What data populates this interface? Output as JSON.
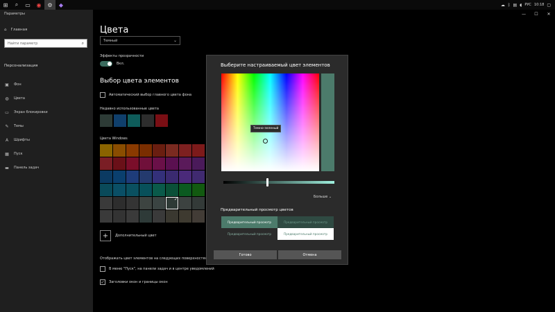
{
  "taskbar": {
    "lang": "РУС",
    "time": "10:18",
    "icons": [
      "windows-icon",
      "search-icon",
      "task-view-icon",
      "chrome-icon",
      "settings-icon",
      "visual-studio-icon"
    ]
  },
  "sidebar": {
    "app_title": "Параметры",
    "home": "Главная",
    "search_placeholder": "Найти параметр",
    "section": "Персонализация",
    "items": [
      {
        "label": "Фон",
        "icon": "image-icon"
      },
      {
        "label": "Цвета",
        "icon": "palette-icon"
      },
      {
        "label": "Экран блокировки",
        "icon": "lock-screen-icon"
      },
      {
        "label": "Темы",
        "icon": "themes-icon"
      },
      {
        "label": "Шрифты",
        "icon": "font-icon"
      },
      {
        "label": "Пуск",
        "icon": "start-icon"
      },
      {
        "label": "Панель задач",
        "icon": "taskbar-icon"
      }
    ]
  },
  "main": {
    "title": "Цвета",
    "mode_value": "Темный",
    "transparency_label": "Эффекты прозрачности",
    "transparency_state": "Вкл.",
    "choose_color_heading": "Выбор цвета элементов",
    "auto_color_label": "Автоматический выбор главного цвета фона",
    "recent_label": "Недавно использованные цвета",
    "recent_colors": [
      "#2d3b36",
      "#0f3f6b",
      "#0e5c5a",
      "#2d2d2d",
      "#7a0e14"
    ],
    "windows_colors_label": "Цвета Windows",
    "windows_colors": [
      "#8a6400",
      "#8a4d00",
      "#8a3a00",
      "#7a2e00",
      "#6a1e10",
      "#7a2a20",
      "#7d2020",
      "#7d1a1a",
      "#7a1e25",
      "#6a1018",
      "#7a0e2a",
      "#70103a",
      "#6a1048",
      "#5a1050",
      "#5a1a5a",
      "#4a1a5a",
      "#0b3a62",
      "#0a3f6e",
      "#1e3c7a",
      "#243a6e",
      "#33307a",
      "#3a2a70",
      "#4a2a7a",
      "#402a70",
      "#0a4a5a",
      "#0a4f66",
      "#0a5060",
      "#08505a",
      "#0a5a4a",
      "#0a5038",
      "#0b5a20",
      "#125a10",
      "#3a3a3a",
      "#2d2d2d",
      "#343434",
      "#3d4441",
      "#3a4442",
      "#2e3a36",
      "#3c4240",
      "#333a38",
      "#3a3a3a",
      "#333333",
      "#3a3a3a",
      "#2e3a38",
      "#3a3a3a",
      "#3a3830",
      "#3e3a30",
      "#423c36"
    ],
    "selected_color_index": 37,
    "add_color_label": "Дополнительный цвет",
    "surfaces_label": "Отображать цвет элементов на следующих поверхностях",
    "surface_start_label": "В меню \"Пуск\", на панели задач и в центре уведомлений",
    "surface_titlebars_label": "Заголовки окон и границы окон"
  },
  "dialog": {
    "title": "Выберите настраиваемый цвет элементов",
    "tooltip": "Темно-зеленый",
    "current_color": "#4c7b6b",
    "more_label": "Больше",
    "preview_heading": "Предварительный просмотр цветов",
    "preview_text": "Предварительный просмотр",
    "ok_label": "Готово",
    "cancel_label": "Отмена"
  }
}
